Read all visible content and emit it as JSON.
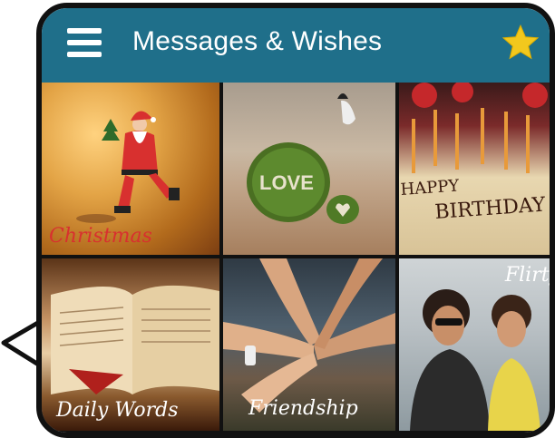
{
  "app": {
    "title": "Messages & Wishes"
  },
  "colors": {
    "topbar": "#1f6f8a",
    "star": "#f2c81d",
    "border": "#111111"
  },
  "icons": {
    "menu": "hamburger-menu-icon",
    "favorites": "star-icon"
  },
  "categories": [
    {
      "label": "Christmas",
      "color": "#d8302f"
    },
    {
      "label": "",
      "color": "#ffffff"
    },
    {
      "label": "",
      "color": "#ffffff"
    },
    {
      "label": "Daily Words",
      "color": "#ffffff"
    },
    {
      "label": "Friendship",
      "color": "#ffffff"
    },
    {
      "label": "Flirty",
      "color": "#ffffff"
    }
  ]
}
